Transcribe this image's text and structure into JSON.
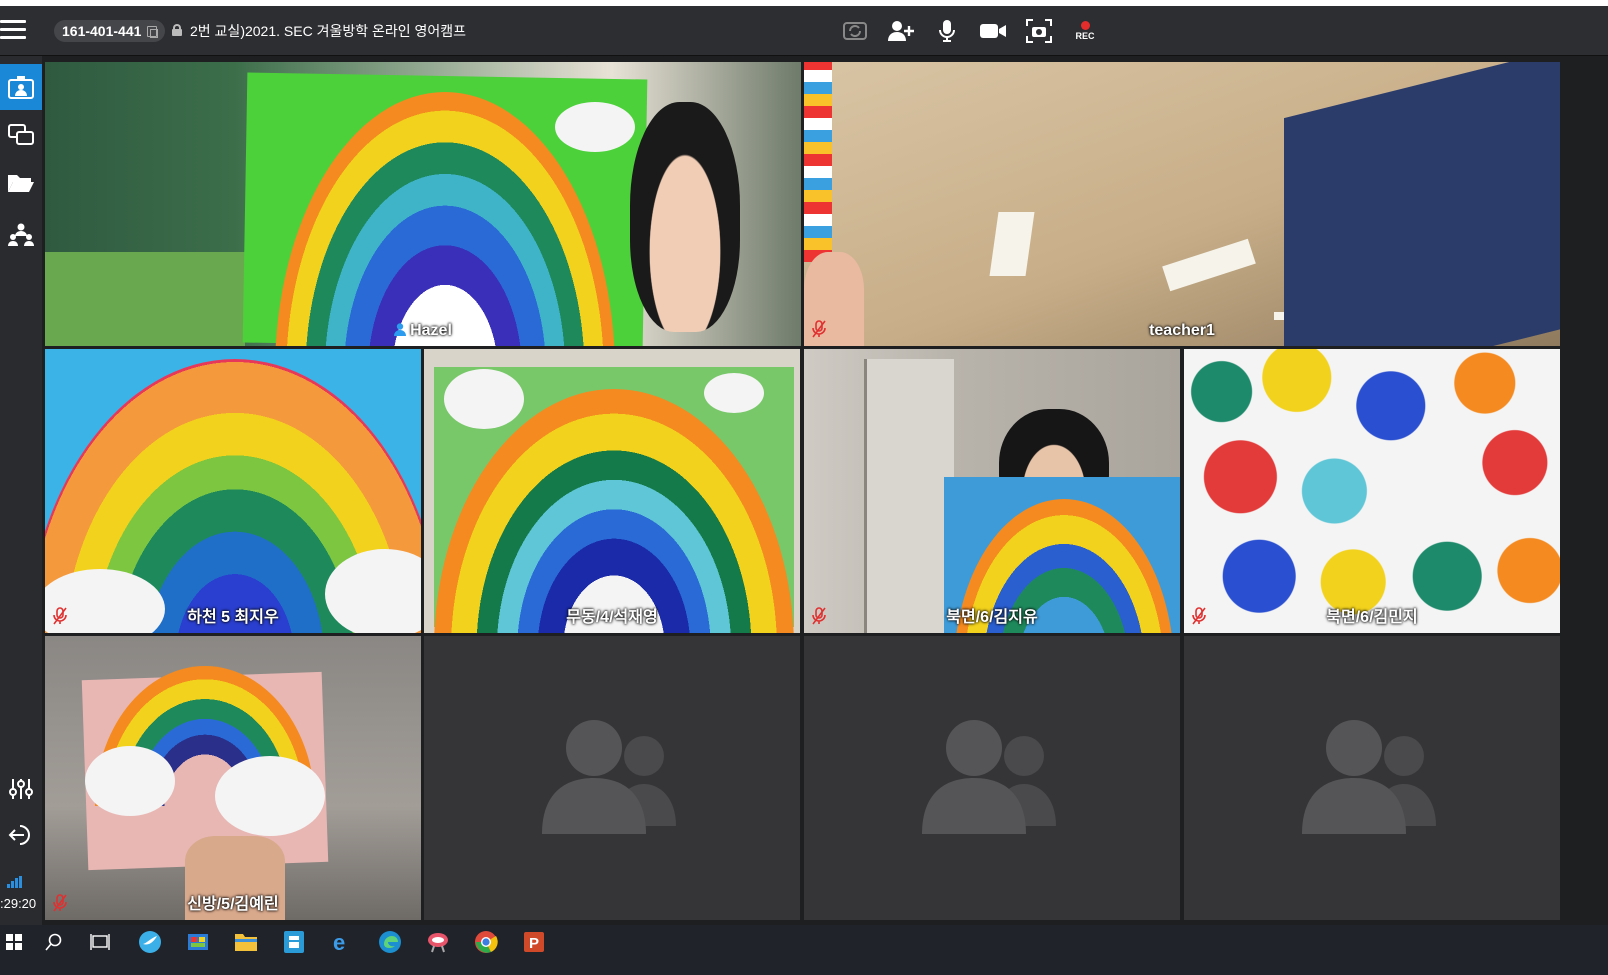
{
  "meeting": {
    "room_id": "161-401-441",
    "room_title": "2번 교실)2021. SEC 겨울방학 온라인 영어캠프",
    "rec_label": "REC",
    "timer": ":29:20"
  },
  "participants": [
    {
      "name": "Hazel",
      "muted": false,
      "host": true
    },
    {
      "name": "teacher1",
      "muted": true,
      "host": false
    },
    {
      "name": "하천 5 최지우",
      "muted": true,
      "host": false
    },
    {
      "name": "무동/4/석재영",
      "muted": false,
      "host": false
    },
    {
      "name": "북면/6/김지유",
      "muted": true,
      "host": false
    },
    {
      "name": "북면/6/김민지",
      "muted": true,
      "host": false
    },
    {
      "name": "신방/5/김예린",
      "muted": true,
      "host": false
    }
  ],
  "icons": {
    "toolbar": [
      "switch-camera-icon",
      "add-participant-icon",
      "microphone-icon",
      "video-camera-icon",
      "screenshot-icon",
      "record-icon"
    ],
    "sidebar": [
      "video-layout-icon",
      "screen-share-icon",
      "folder-icon",
      "participants-icon",
      "settings-sliders-icon",
      "exit-icon"
    ],
    "taskbar": [
      "windows-start-icon",
      "search-icon",
      "task-view-icon",
      "app-icon",
      "app-icon",
      "file-explorer-icon",
      "app-icon",
      "internet-explorer-icon",
      "edge-icon",
      "app-icon",
      "chrome-icon",
      "powerpoint-icon"
    ]
  },
  "colors": {
    "accent": "#1a88d6",
    "rec": "#e32c2c",
    "mute": "#e03030"
  }
}
